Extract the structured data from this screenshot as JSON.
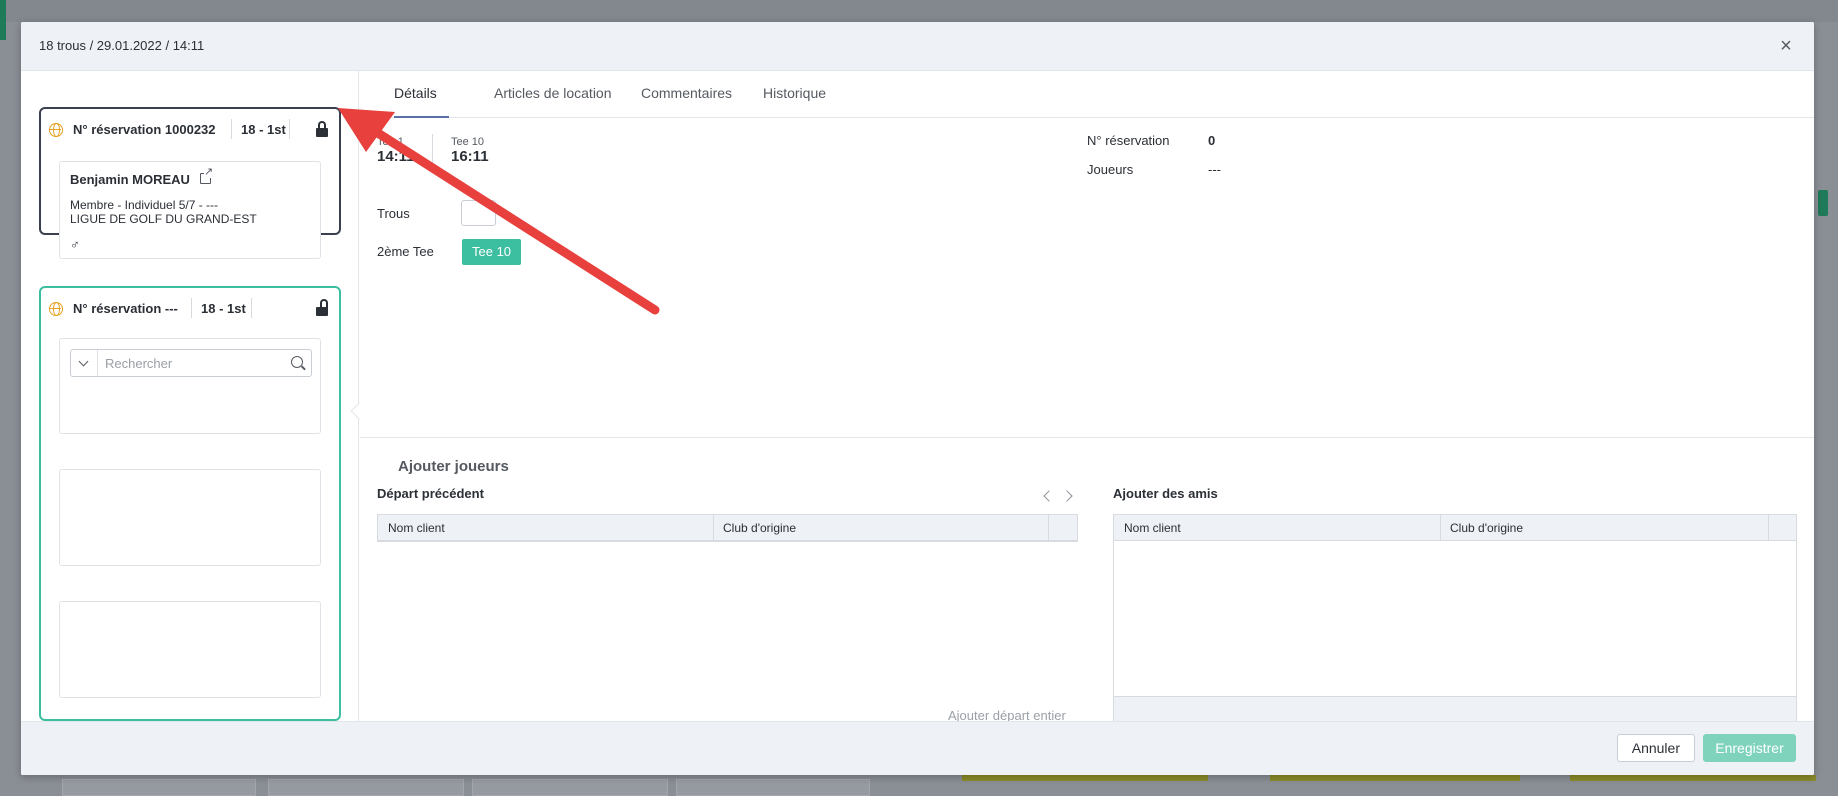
{
  "modal": {
    "title": "18 trous / 29.01.2022 / 14:11",
    "close_glyph": "×"
  },
  "reservations": [
    {
      "number": "N° réservation 1000232",
      "holes": "18 - 1st",
      "locked": true,
      "player": {
        "name": "Benjamin MOREAU",
        "membership": "Membre - Individuel 5/7 - ---",
        "club": "LIGUE DE GOLF DU GRAND-EST",
        "gender_glyph": "♂"
      }
    },
    {
      "number": "N° réservation ---",
      "holes": "18 - 1st",
      "locked": false,
      "search": {
        "placeholder": "Rechercher"
      }
    }
  ],
  "tabs": [
    {
      "label": "Détails",
      "active": true
    },
    {
      "label": "Articles de location",
      "active": false
    },
    {
      "label": "Commentaires",
      "active": false
    },
    {
      "label": "Historique",
      "active": false
    }
  ],
  "details": {
    "tee1_label": "Tee 1",
    "tee1_time": "14:11",
    "tee10_label": "Tee 10",
    "tee10_time": "16:11",
    "holes_label": "Trous",
    "second_tee_label": "2ème Tee",
    "second_tee_value": "Tee 10",
    "reservation_label": "N° réservation",
    "reservation_value": "0",
    "players_label": "Joueurs",
    "players_value": "---"
  },
  "add_players": {
    "title": "Ajouter joueurs",
    "previous_departure": {
      "title": "Départ précédent",
      "columns": [
        "Nom client",
        "Club d'origine"
      ],
      "add_all_label": "Ajouter départ entier"
    },
    "friends": {
      "title": "Ajouter des amis",
      "columns": [
        "Nom client",
        "Club d'origine"
      ]
    }
  },
  "footer": {
    "cancel_label": "Annuler",
    "save_label": "Enregistrer"
  },
  "colors": {
    "accent_teal": "#3cbea0",
    "save_disabled": "#7fd3bd",
    "annotation_red": "#e8403c",
    "globe_orange": "#e8a020"
  }
}
